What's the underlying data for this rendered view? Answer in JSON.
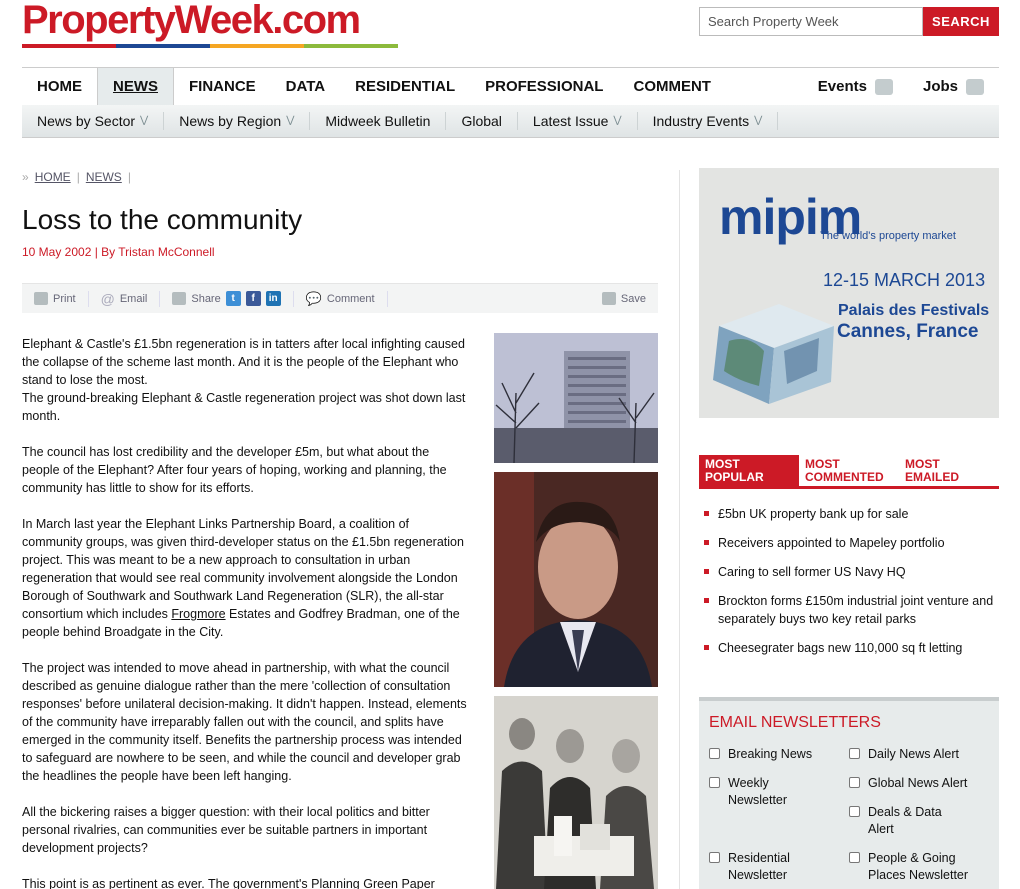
{
  "header": {
    "logo": "PropertyWeek.com",
    "logo_bar_colors": [
      "#cc1a26",
      "#1d4894",
      "#f5a623",
      "#8cba3c"
    ],
    "search_placeholder": "Search Property Week",
    "search_button": "SEARCH"
  },
  "nav": {
    "items": [
      "HOME",
      "NEWS",
      "FINANCE",
      "DATA",
      "RESIDENTIAL",
      "PROFESSIONAL",
      "COMMENT"
    ],
    "active": "NEWS",
    "right": [
      "Events",
      "Jobs"
    ]
  },
  "subnav": {
    "items": [
      "News by Sector",
      "News by Region",
      "Midweek Bulletin",
      "Global",
      "Latest Issue",
      "Industry Events"
    ]
  },
  "breadcrumb": [
    "HOME",
    "NEWS"
  ],
  "article": {
    "title": "Loss to the community",
    "byline": "10 May 2002 | By Tristan McConnell",
    "toolbar": {
      "print": "Print",
      "email": "Email",
      "share": "Share",
      "comment": "Comment",
      "save": "Save"
    },
    "paragraphs": [
      "Elephant & Castle's £1.5bn regeneration is in tatters after local infighting caused the collapse of the scheme last month. And it is the people of the Elephant who stand to lose the most.",
      "The ground-breaking Elephant & Castle regeneration project was shot down last month.",
      "The council has lost credibility and the developer £5m, but what about the people of the Elephant? After four years of hoping, working and planning, the community has little to show for its efforts.",
      "In March last year the Elephant Links Partnership Board, a coalition of community groups, was given third-developer status on the £1.5bn regeneration project. This was meant to be a new approach to consultation in urban regeneration that would see real community involvement alongside the London Borough of Southwark and Southwark Land Regeneration (SLR), the all-star consortium which includes ",
      "Frogmore",
      " Estates and Godfrey Bradman, one of the people behind Broadgate in the City.",
      "The project was intended to move ahead in partnership, with what the council described as genuine dialogue rather than the mere 'collection of consultation responses' before unilateral decision-making. It didn't happen. Instead, elements of the community have irreparably fallen out with the council, and splits have emerged in the community itself. Benefits the partnership process was intended to safeguard are nowhere to be seen, and while the council and developer grab the headlines the people have been left hanging.",
      "All the bickering raises a bigger question: with their local politics and bitter personal rivalries, can communities ever be suitable partners in important development projects?",
      "This point is as pertinent as ever. The government's Planning Green Paper"
    ]
  },
  "ad": {
    "logo": "mipim",
    "tagline": "The world's property market",
    "date": "12-15 MARCH 2013",
    "venue1": "Palais des Festivals",
    "venue2": "Cannes, France"
  },
  "popular": {
    "tabs": [
      "MOST POPULAR",
      "MOST COMMENTED",
      "MOST EMAILED"
    ],
    "items": [
      "£5bn UK property bank up for sale",
      "Receivers appointed to Mapeley portfolio",
      "Caring to sell former US Navy HQ",
      "Brockton forms £150m industrial joint venture and separately buys two key retail parks",
      "Cheesegrater bags new 110,000 sq ft letting"
    ]
  },
  "newsletters": {
    "title": "EMAIL NEWSLETTERS",
    "items": [
      "Breaking News",
      "Daily News Alert",
      "Weekly Newsletter",
      "Global News Alert",
      "Deals & Data Alert",
      "Residential Newsletter",
      "People & Going Places Newsletter"
    ]
  }
}
